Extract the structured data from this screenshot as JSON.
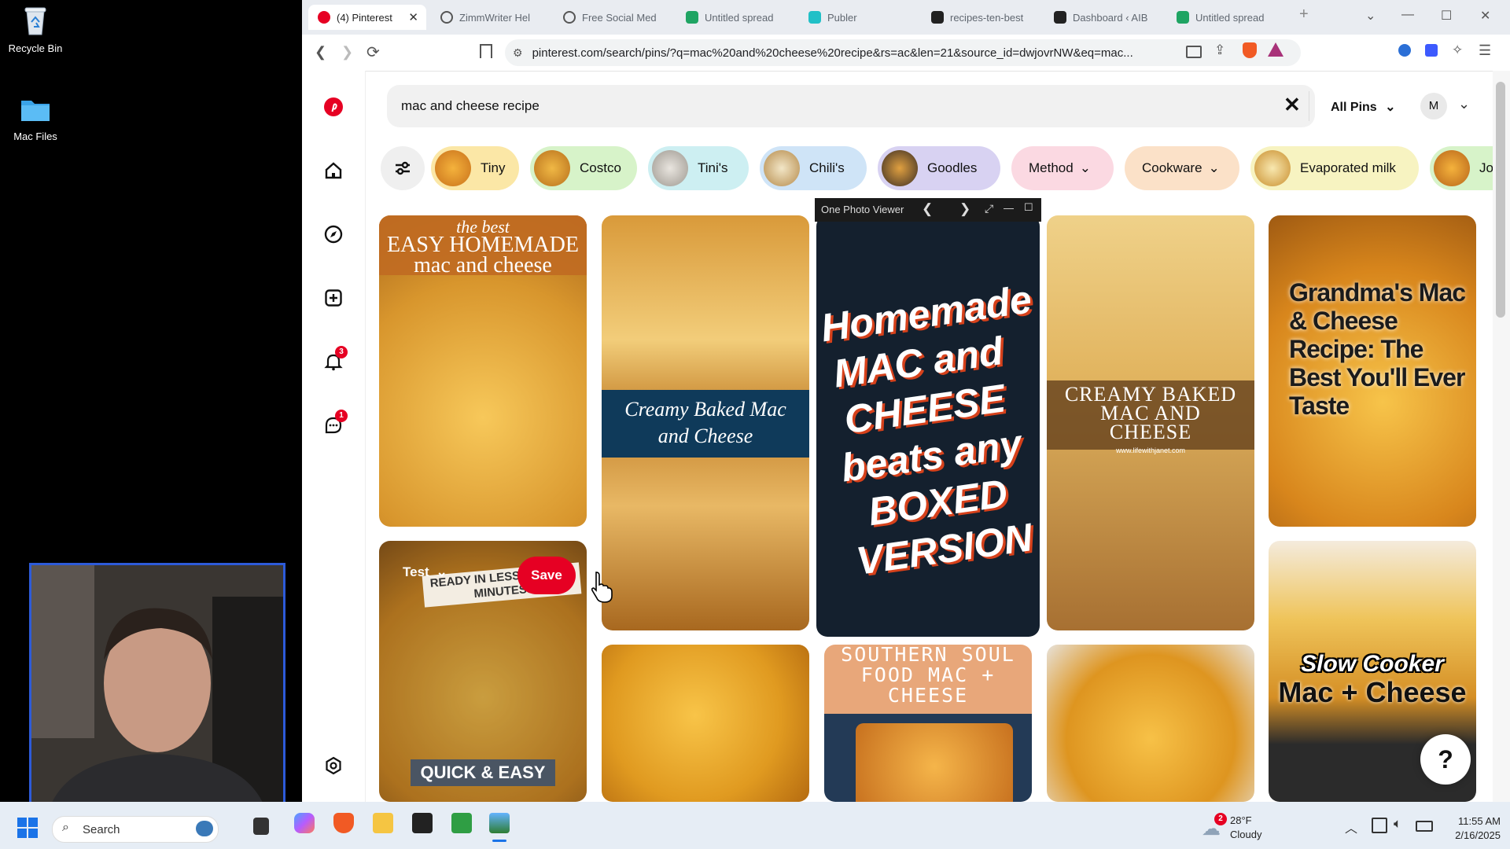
{
  "desktop": {
    "icons": [
      {
        "label": "Recycle Bin"
      },
      {
        "label": "Mac Files"
      }
    ]
  },
  "browser": {
    "tabs": [
      {
        "label": "(4) Pinterest",
        "active": true
      },
      {
        "label": "ZimmWriter Hel"
      },
      {
        "label": "Free Social Med"
      },
      {
        "label": "Untitled spread"
      },
      {
        "label": "Publer"
      },
      {
        "label": "recipes-ten-best"
      },
      {
        "label": "Dashboard ‹ AIB"
      },
      {
        "label": "Untitled spread"
      }
    ],
    "url": "pinterest.com/search/pins/?q=mac%20and%20cheese%20recipe&rs=ac&len=21&source_id=dwjovrNW&eq=mac..."
  },
  "pinterest": {
    "search_value": "mac and cheese recipe",
    "filter_label": "All Pins",
    "avatar_initial": "M",
    "notification_count": "3",
    "message_count": "1",
    "chips": [
      {
        "label": "Tiny",
        "color": "#fbe7a6"
      },
      {
        "label": "Costco",
        "color": "#d7f3c9"
      },
      {
        "label": "Tini's",
        "color": "#cdeff2"
      },
      {
        "label": "Chili's",
        "color": "#cfe4f7"
      },
      {
        "label": "Goodles",
        "color": "#d8d2f2"
      },
      {
        "label": "Method",
        "color": "#fbd9e2"
      },
      {
        "label": "Cookware",
        "color": "#fbe1c8"
      },
      {
        "label": "Evaporated milk",
        "color": "#f7f3c1"
      },
      {
        "label": "John l",
        "color": "#d7f3c9"
      }
    ],
    "pins": {
      "p1": {
        "line1": "the best",
        "line2": "EASY HOMEMADE",
        "line3": "mac and cheese"
      },
      "p2": {
        "caption": "Creamy Baked Mac and Cheese"
      },
      "p3": {
        "title": "Homemade MAC and CHEESE beats any BOXED VERSION"
      },
      "p4": {
        "caption": "CREAMY BAKED MAC AND CHEESE",
        "sub": "www.lifewithjanet.com"
      },
      "p5": {
        "caption": "Grandma's Mac & Cheese Recipe: The Best You'll Ever Taste"
      },
      "p6": {
        "board": "Test",
        "save": "Save",
        "banner": "READY IN LESS THAN 20 MINUTES!",
        "footer": "QUICK & EASY"
      },
      "p8": {
        "caption": "SOUTHERN SOUL FOOD MAC + CHEESE"
      },
      "p10": {
        "line1": "Slow Cooker",
        "line2": "Mac + Cheese"
      }
    },
    "photo_viewer": {
      "title": "One Photo Viewer"
    },
    "help_label": "?"
  },
  "taskbar": {
    "search_placeholder": "Search",
    "weather_temp": "28°F",
    "weather_desc": "Cloudy",
    "weather_badge": "2",
    "time": "11:55 AM",
    "date": "2/16/2025"
  }
}
